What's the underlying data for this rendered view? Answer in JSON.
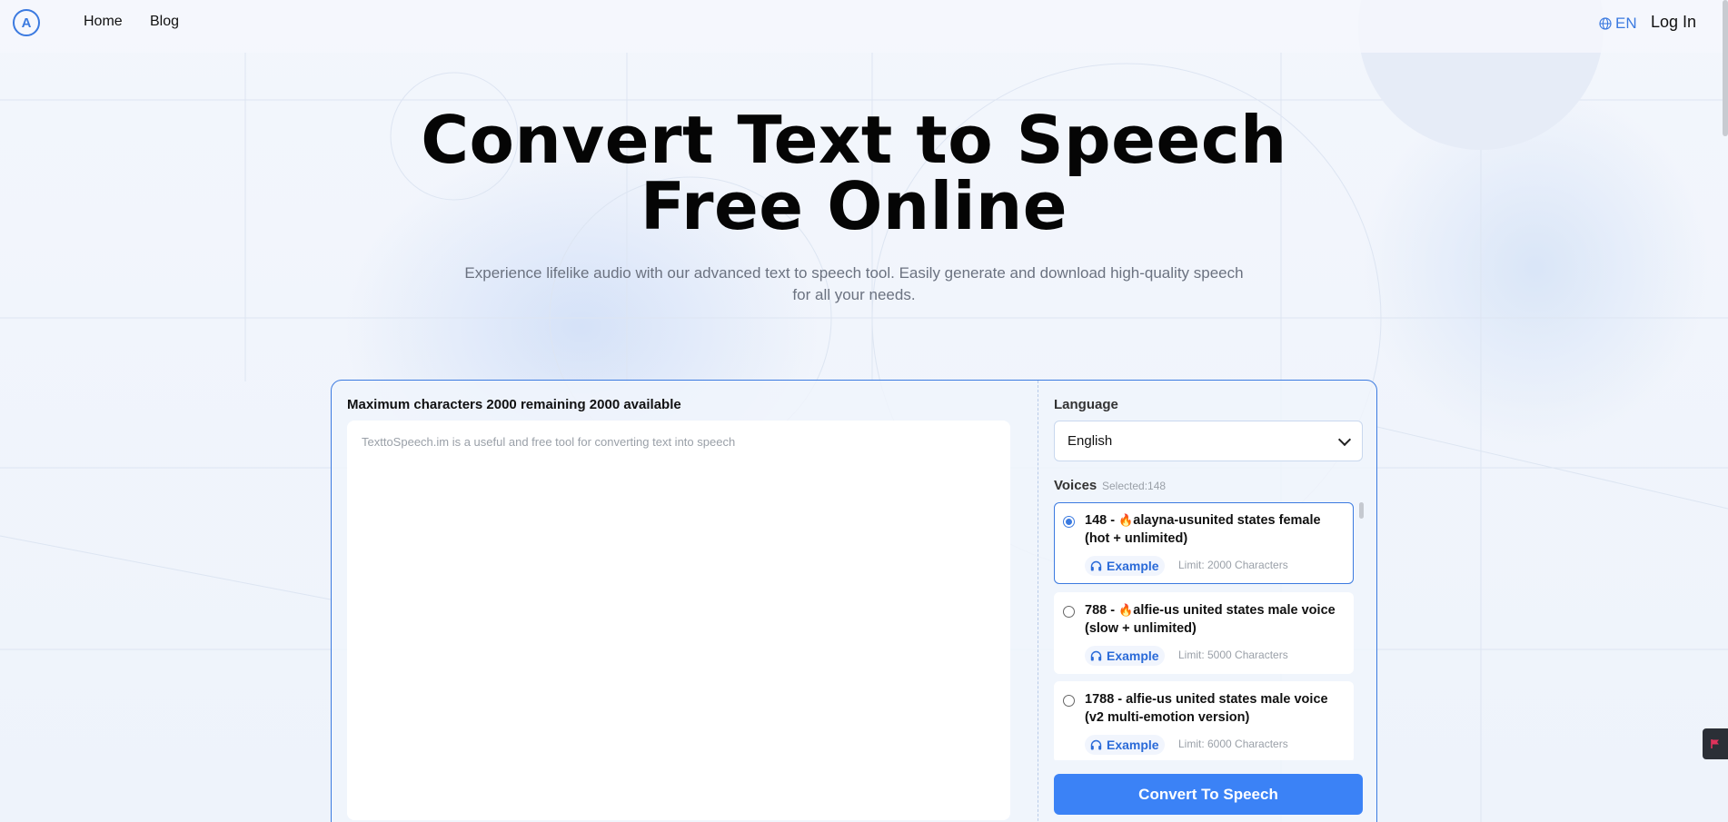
{
  "header": {
    "logo_text": "A",
    "nav": [
      {
        "label": "Home"
      },
      {
        "label": "Blog"
      }
    ],
    "language": "EN",
    "login_label": "Log In"
  },
  "hero": {
    "title_line1": "Convert Text to Speech",
    "title_line2": "Free Online",
    "subtitle": "Experience lifelike audio with our advanced text to speech tool. Easily generate and download high-quality speech for all your needs."
  },
  "tool": {
    "char_info": "Maximum characters 2000 remaining 2000 available",
    "textarea_placeholder": "TexttoSpeech.im is a useful and free tool for converting text into speech",
    "textarea_value": "",
    "language_label": "Language",
    "language_selected": "English",
    "voices_label": "Voices",
    "voices_selected": "Selected:148",
    "voices": [
      {
        "id": "148",
        "text": "148 - ",
        "hot": true,
        "name": "alayna-us",
        "name_rest": "united states female (hot + unlimited)",
        "example_label": "Example",
        "limit": "Limit: 2000 Characters",
        "selected": true
      },
      {
        "id": "788",
        "text": "788 - ",
        "hot": true,
        "name": "alfie-us",
        "name_rest": " united states male voice (slow + unlimited)",
        "example_label": "Example",
        "limit": "Limit: 5000 Characters",
        "selected": false
      },
      {
        "id": "1788",
        "text": "1788 - ",
        "hot": false,
        "name": "alfie-us",
        "name_rest": " united states male voice (v2 multi-emotion version)",
        "example_label": "Example",
        "limit": "Limit: 6000 Characters",
        "selected": false
      }
    ],
    "convert_label": "Convert To Speech"
  },
  "colors": {
    "accent": "#3b7ae0",
    "button": "#3b82f6",
    "background": "#eef3fb"
  }
}
